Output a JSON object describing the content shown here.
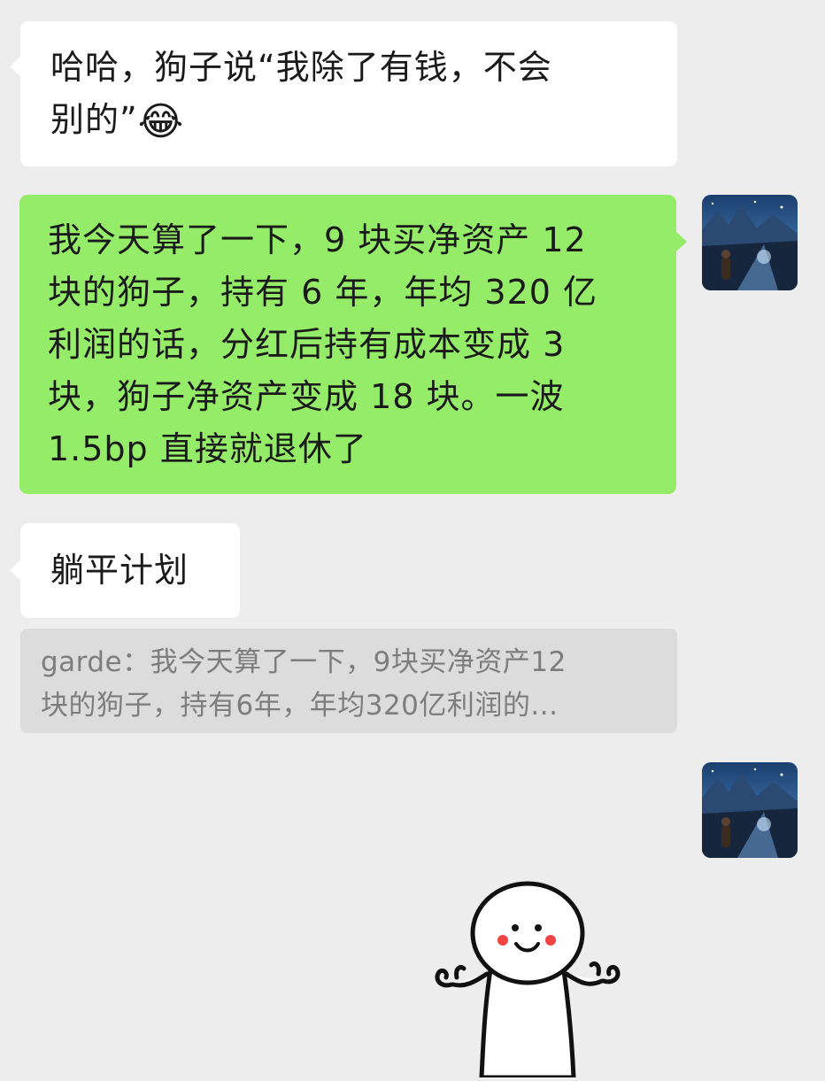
{
  "messages": [
    {
      "side": "left",
      "text_line1": "哈哈，狗子说“我除了有钱，不会",
      "text_line2": "别的”",
      "emoji": "😂"
    },
    {
      "side": "right",
      "lines": [
        "我今天算了一下，9 块买净资产 12",
        "块的狗子，持有 6 年，年均 320 亿",
        "利润的话，分红后持有成本变成 3",
        "块，狗子净资产变成 18 块。一波",
        "1.5bp 直接就退休了"
      ]
    },
    {
      "side": "left",
      "text": "躺平计划",
      "quote_line1": "garde：我今天算了一下，9块买净资产12",
      "quote_line2": "块的狗子，持有6年，年均320亿利润的..."
    },
    {
      "side": "right",
      "sticker": "shrugging-stick-figure"
    }
  ],
  "colors": {
    "background": "#ededed",
    "incoming_bubble": "#ffffff",
    "outgoing_bubble": "#95ec69",
    "quote_background": "#dcdcdc",
    "quote_text": "#7d7d7d"
  },
  "icons": {
    "avatar": "night-sky-avatar",
    "emoji": "tears-of-joy-emoji",
    "sticker": "shrugging-stick-figure"
  }
}
